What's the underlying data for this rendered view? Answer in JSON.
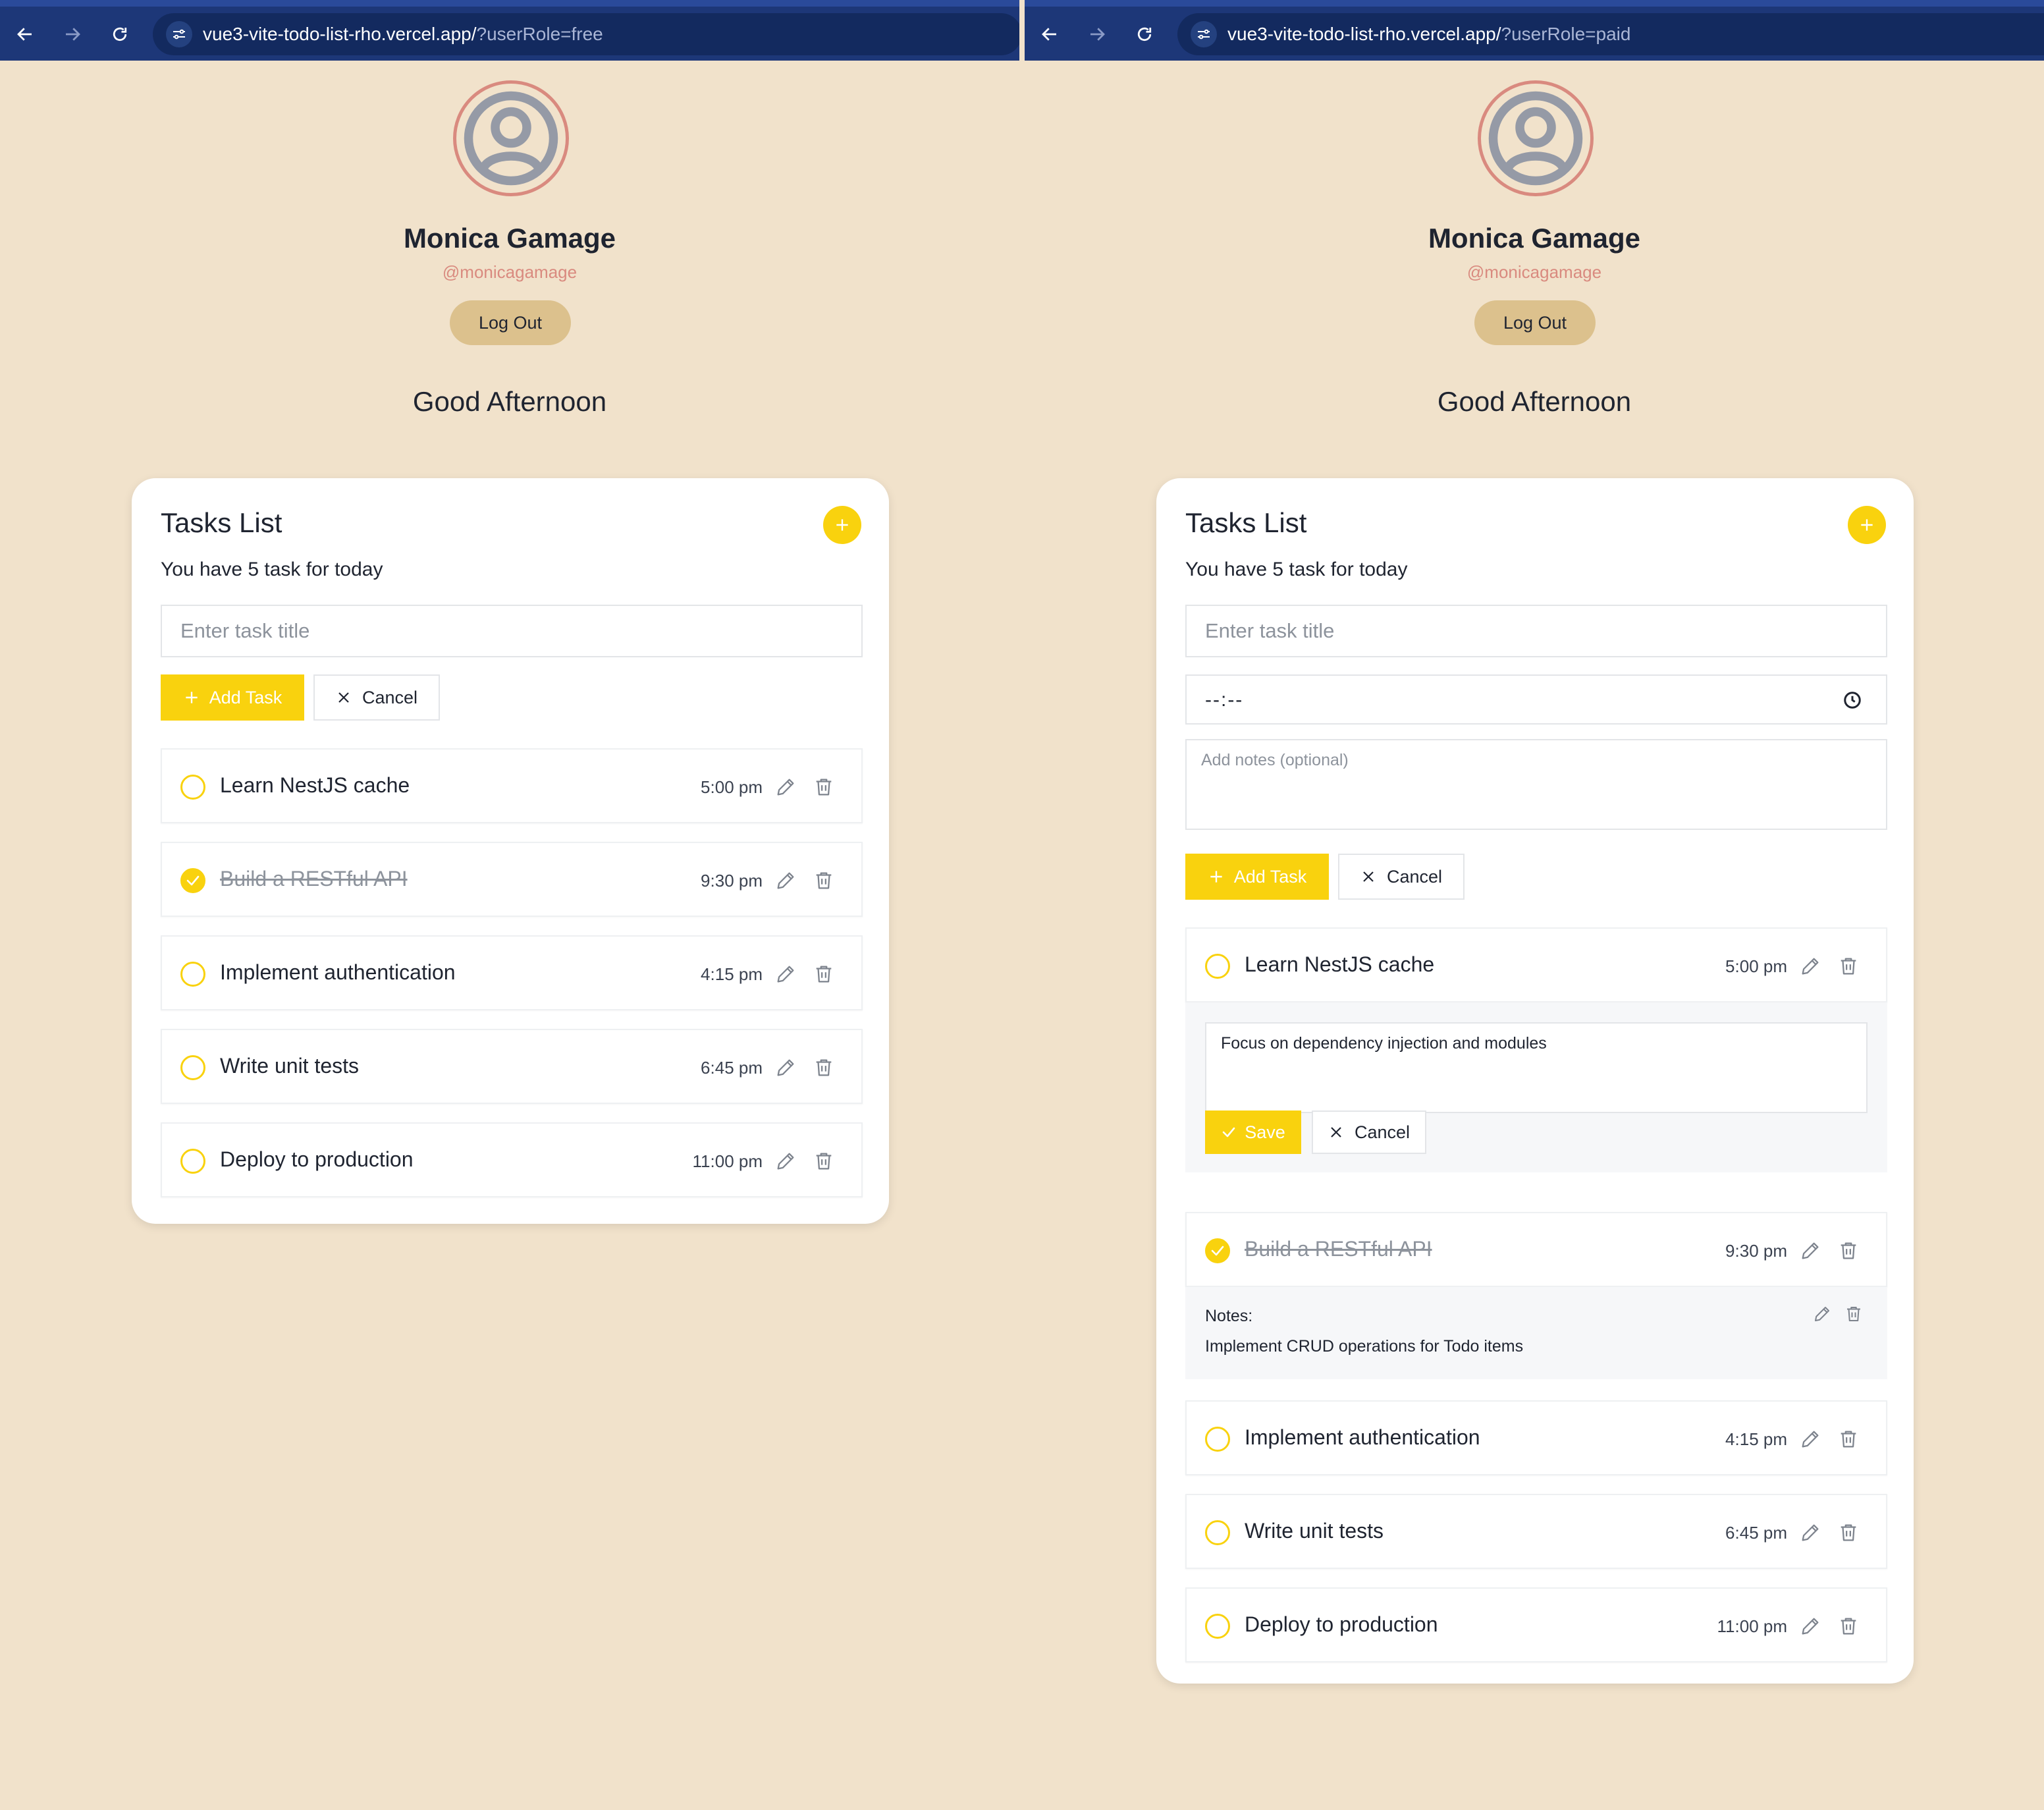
{
  "colors": {
    "background": "#f1e2cb",
    "browser_bar": "#1d3778",
    "accent": "#f9d20e",
    "avatar_ring": "#d98a7f",
    "logout_button": "#dcc18d"
  },
  "icons": {
    "back": "arrow-left-icon",
    "forward": "arrow-right-icon",
    "reload": "reload-icon",
    "site_settings": "tune-icon",
    "avatar": "user-circle-icon",
    "add": "plus-icon",
    "close": "x-icon",
    "check": "check-icon",
    "edit": "pencil-icon",
    "delete": "trash-icon",
    "clock": "clock-icon"
  },
  "left": {
    "browser": {
      "url_host": "vue3-vite-todo-list-rho.vercel.app/",
      "url_query": "?userRole=free"
    },
    "profile": {
      "name": "Monica Gamage",
      "handle": "@monicagamage",
      "logout_label": "Log Out",
      "greeting": "Good Afternoon"
    },
    "card": {
      "title": "Tasks List",
      "subtitle": "You have 5 task for today",
      "title_placeholder": "Enter task title",
      "add_label": "Add Task",
      "cancel_label": "Cancel",
      "tasks": [
        {
          "title": "Learn NestJS cache",
          "time": "5:00 pm",
          "done": false
        },
        {
          "title": "Build a RESTful API",
          "time": "9:30 pm",
          "done": true
        },
        {
          "title": "Implement authentication",
          "time": "4:15 pm",
          "done": false
        },
        {
          "title": "Write unit tests",
          "time": "6:45 pm",
          "done": false
        },
        {
          "title": "Deploy to production",
          "time": "11:00 pm",
          "done": false
        }
      ]
    }
  },
  "right": {
    "browser": {
      "url_host": "vue3-vite-todo-list-rho.vercel.app/",
      "url_query": "?userRole=paid"
    },
    "profile": {
      "name": "Monica Gamage",
      "handle": "@monicagamage",
      "logout_label": "Log Out",
      "greeting": "Good Afternoon"
    },
    "card": {
      "title": "Tasks List",
      "subtitle": "You have 5 task for today",
      "title_placeholder": "Enter task title",
      "time_value": "--:--",
      "notes_placeholder": "Add notes (optional)",
      "add_label": "Add Task",
      "cancel_label": "Cancel",
      "tasks": [
        {
          "title": "Learn NestJS cache",
          "time": "5:00 pm",
          "done": false
        },
        {
          "title": "Build a RESTful API",
          "time": "9:30 pm",
          "done": true
        },
        {
          "title": "Implement authentication",
          "time": "4:15 pm",
          "done": false
        },
        {
          "title": "Write unit tests",
          "time": "6:45 pm",
          "done": false
        },
        {
          "title": "Deploy to production",
          "time": "11:00 pm",
          "done": false
        }
      ],
      "edit_panel": {
        "notes_value": "Focus on dependency injection and modules",
        "save_label": "Save",
        "cancel_label": "Cancel"
      },
      "notes_panel": {
        "label": "Notes:",
        "text": "Implement CRUD operations for Todo items"
      }
    }
  }
}
